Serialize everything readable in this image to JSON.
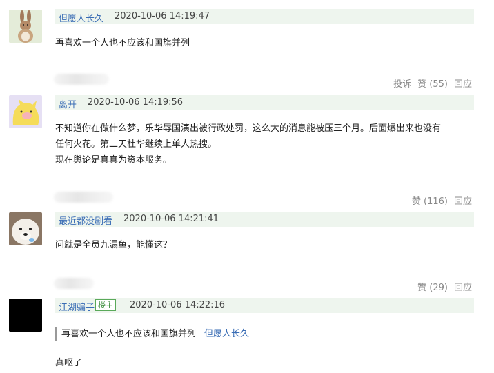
{
  "comments": [
    {
      "username": "但愿人长久",
      "time": "2020-10-06 14:19:47",
      "text": "再喜欢一个人也不应该和国旗并列",
      "avatar_icon": "bunny-avatar-icon"
    },
    {
      "username": "离开",
      "time": "2020-10-06 14:19:56",
      "text_lines": [
        "不知道你在做什么梦，乐华辱国演出被行政处罚，这么大的消息能被压三个月。后面爆出来也没有",
        "任何火花。第二天杜华继续上单人热搜。",
        "现在舆论是真真为资本服务。"
      ],
      "avatar_icon": "yellow-cat-avatar-icon"
    },
    {
      "username": "最近都没剧看",
      "time": "2020-10-06 14:21:41",
      "text": "问就是全员九漏鱼，能懂这？",
      "avatar_icon": "white-dog-avatar-icon"
    },
    {
      "username": "江湖骗子",
      "badge": "楼主",
      "time": "2020-10-06 14:22:16",
      "quote_text": "再喜欢一个人也不应该和国旗并列",
      "quote_user": "但愿人长久",
      "text": "真呕了",
      "avatar_icon": "black-square-avatar-icon"
    }
  ],
  "actions": {
    "report": "投诉",
    "like": "赞",
    "reply": "回应",
    "counts": [
      "(55)",
      "(116)",
      "(29)"
    ]
  },
  "colors": {
    "username": "#3a6db5",
    "header_bg": "#eef5ee",
    "badge": "#3e8f3e",
    "muted": "#888888"
  }
}
